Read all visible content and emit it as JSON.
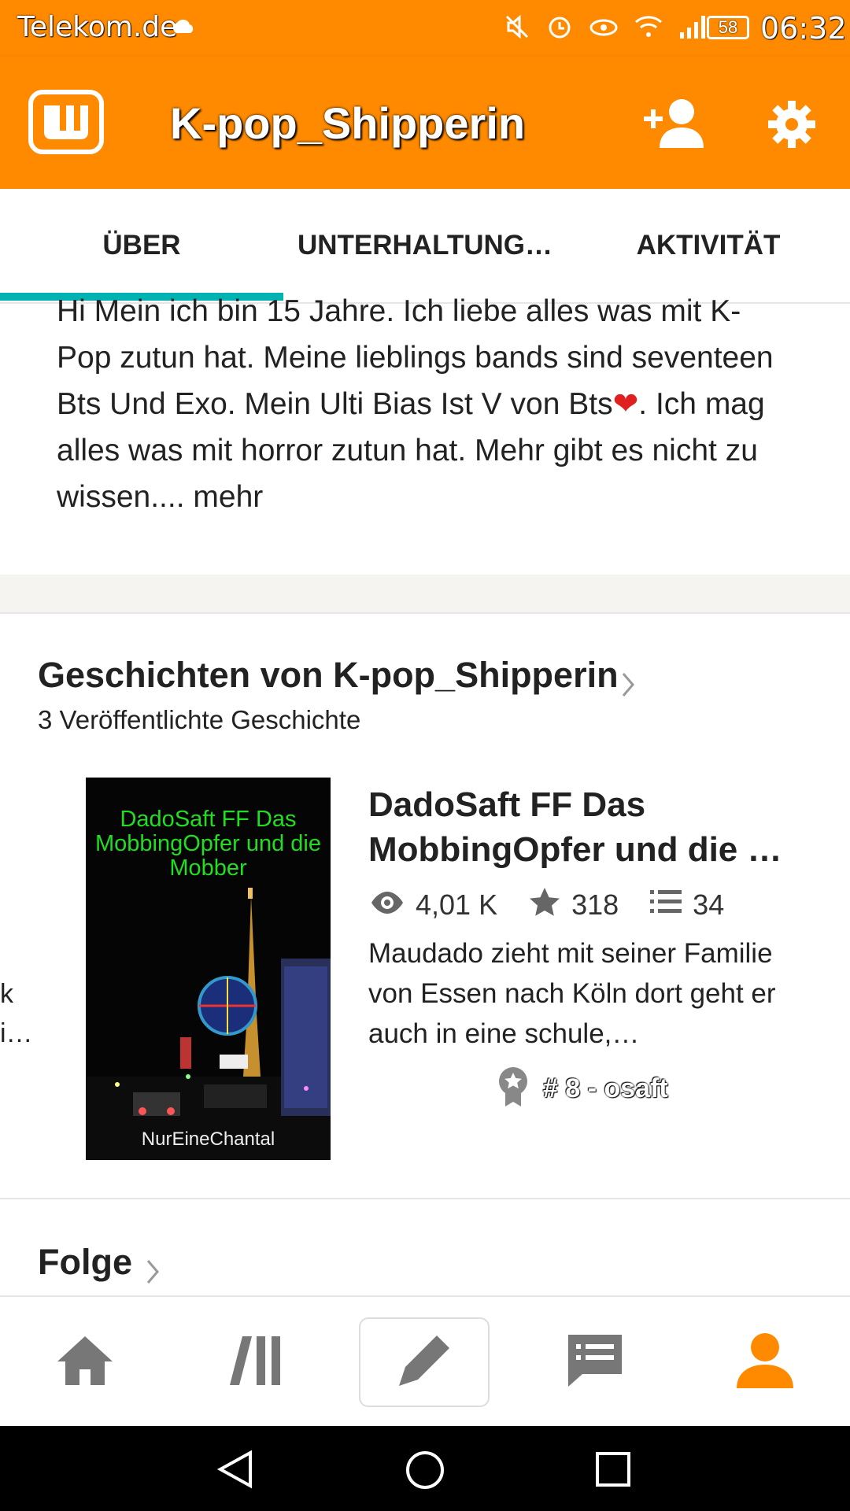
{
  "status_bar": {
    "carrier": "Telekom.de",
    "battery": "58",
    "time": "06:32"
  },
  "header": {
    "title": "K-pop_Shipperin"
  },
  "tabs": [
    {
      "label": "ÜBER",
      "active": true
    },
    {
      "label": "UNTERHALTUNG…",
      "active": false
    },
    {
      "label": "AKTIVITÄT",
      "active": false
    }
  ],
  "about": {
    "text": "Hi Mein ich bin 15 Jahre. Ich liebe alles was mit K-Pop zutun hat. Meine lieblings bands sind seventeen Bts Und Exo. Mein Ulti Bias Ist V von Bts",
    "heart": "❤",
    "text_after": ". Ich mag alles was mit horror zutun hat. Mehr gibt es nicht zu wissen....",
    "more_label": " mehr"
  },
  "stories": {
    "heading": "Geschichten von K-pop_Shipperin",
    "count_label": "3 Veröffentlichte Geschichte",
    "items": [
      {
        "cover_title": "DadoSaft FF Das MobbingOpfer und die Mobber",
        "cover_author": "NurEineChantal",
        "title": "DadoSaft FF Das MobbingOpfer und die …",
        "reads": "4,01 K",
        "votes": "318",
        "parts": "34",
        "description": "Maudado zieht mit seiner Familie von Essen nach Köln dort geht er auch in eine schule,…",
        "rank": "# 8 - osaft"
      }
    ],
    "peek_fragment_1": "k",
    "peek_fragment_2": "i…"
  },
  "following": {
    "heading": "Folge"
  },
  "bottom_nav": [
    {
      "name": "home",
      "icon": "home-icon"
    },
    {
      "name": "library",
      "icon": "library-icon"
    },
    {
      "name": "write",
      "icon": "pencil-icon"
    },
    {
      "name": "messages",
      "icon": "message-icon"
    },
    {
      "name": "profile",
      "icon": "profile-icon",
      "active": true
    }
  ],
  "colors": {
    "brand_orange": "#FF8A00",
    "tab_indicator": "#00B2B2",
    "cover_title": "#22DD22"
  }
}
